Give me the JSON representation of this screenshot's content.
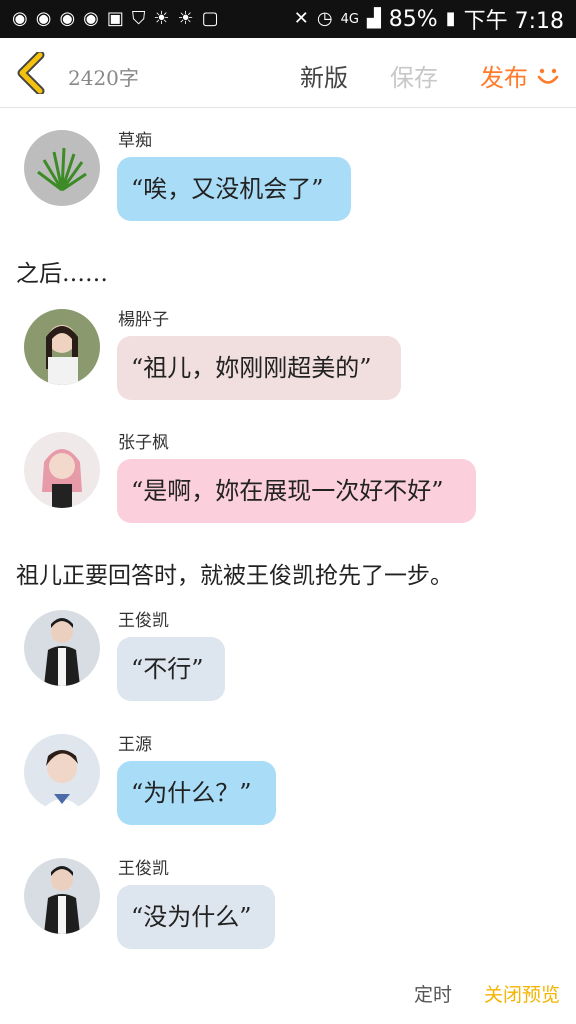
{
  "status_bar": {
    "battery": "85%",
    "time": "下午 7:18",
    "network": "4G"
  },
  "topbar": {
    "word_count": "2420字",
    "new_label": "新版",
    "save_label": "保存",
    "publish_label": "发布"
  },
  "messages": [
    {
      "name": "草痴",
      "text": "“唉，又没机会了”",
      "bubble_color": "#a9dcf6"
    },
    {
      "name": "楊肸子",
      "text": "“祖儿，妳刚刚超美的”",
      "bubble_color": "#f1dede"
    },
    {
      "name": "张子枫",
      "text": "“是啊，妳在展现一次好不好”",
      "bubble_color": "#fbd0dc"
    },
    {
      "name": "王俊凯",
      "text": "“不行”",
      "bubble_color": "#dde6ee"
    },
    {
      "name": "王源",
      "text": "“为什么？”",
      "bubble_color": "#a9dcf6"
    },
    {
      "name": "王俊凯",
      "text": "“没为什么”",
      "bubble_color": "#dde6ee"
    }
  ],
  "narration": [
    "之后……",
    "祖儿正要回答时，就被王俊凯抢先了一步。"
  ],
  "bottom": {
    "timer_label": "定时",
    "close_preview_label": "关闭预览"
  },
  "colors": {
    "accent": "#ff7b2b",
    "back_arrow": "#f4c20d",
    "close_preview": "#f4b400"
  }
}
